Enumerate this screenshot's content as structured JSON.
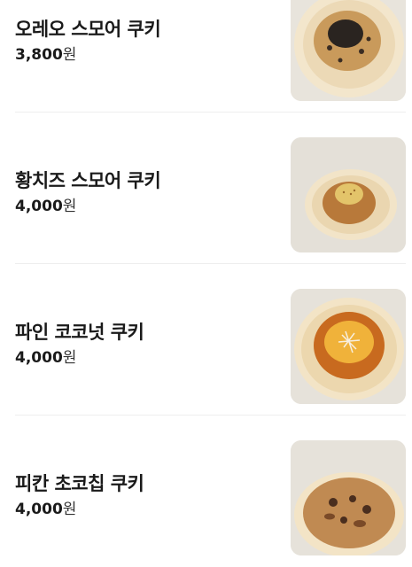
{
  "menu": {
    "items": [
      {
        "name": "오레오 스모어 쿠키",
        "price": "3,800",
        "currency": "원",
        "image": "oreo-smore-cookie-photo",
        "cookie_color": "#c99a5b",
        "topping_color": "#2a2420"
      },
      {
        "name": "황치즈 스모어 쿠키",
        "price": "4,000",
        "currency": "원",
        "image": "cheese-smore-cookie-photo",
        "cookie_color": "#b8793a",
        "topping_color": "#e3c46a"
      },
      {
        "name": "파인 코코넛 쿠키",
        "price": "4,000",
        "currency": "원",
        "image": "pine-coconut-cookie-photo",
        "cookie_color": "#c86a1f",
        "topping_color": "#f0b23a"
      },
      {
        "name": "피칸 초코칩 쿠키",
        "price": "4,000",
        "currency": "원",
        "image": "pecan-chocochip-cookie-photo",
        "cookie_color": "#c08a52",
        "topping_color": "#4a2e1e"
      }
    ]
  }
}
